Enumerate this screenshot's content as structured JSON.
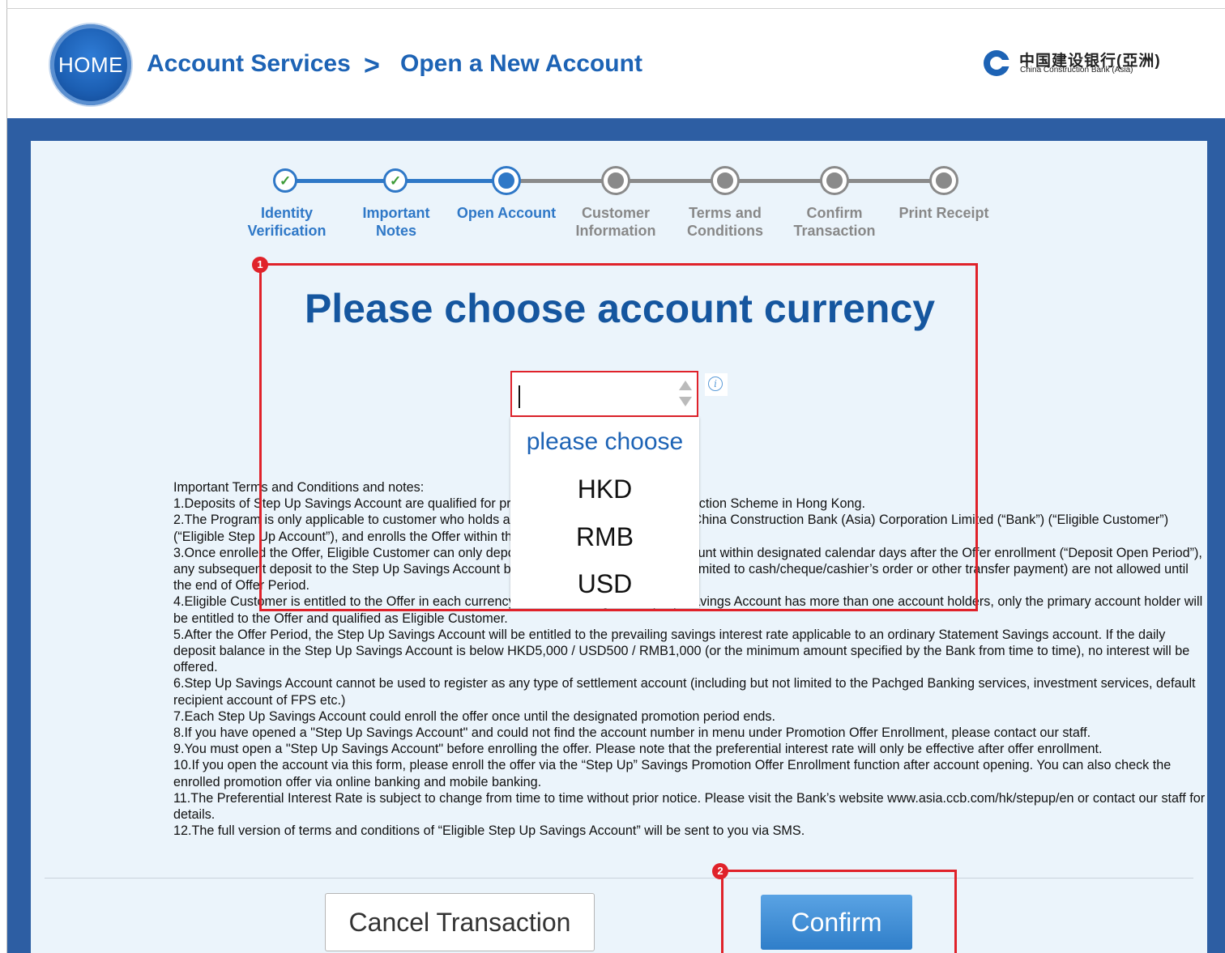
{
  "header": {
    "home_label": "HOME",
    "breadcrumb": [
      "Account Services",
      "Open a New Account"
    ],
    "breadcrumb_separator": ">",
    "bank_name_cn": "中国建设银行(亞洲)",
    "bank_name_en": "China Construction Bank (Asia)"
  },
  "steps": [
    {
      "label": "Identity Verification",
      "state": "done"
    },
    {
      "label": "Important Notes",
      "state": "done"
    },
    {
      "label": "Open Account",
      "state": "current"
    },
    {
      "label": "Customer Information",
      "state": "todo"
    },
    {
      "label": "Terms and Conditions",
      "state": "todo"
    },
    {
      "label": "Confirm Transaction",
      "state": "todo"
    },
    {
      "label": "Print Receipt",
      "state": "todo"
    }
  ],
  "annotations": [
    "1",
    "2"
  ],
  "main": {
    "title": "Please choose account currency",
    "currency_select": {
      "value": "",
      "options": [
        "please choose",
        "HKD",
        "RMB",
        "USD"
      ]
    },
    "info_icon": "i"
  },
  "terms": [
    "Important Terms and Conditions and notes:",
    "1.Deposits of Step Up Savings Account are qualified for protection under the Deposit Protection Scheme in Hong Kong.",
    "2.The Program is only applicable to customer who holds a Step Up Savings Account with China Construction Bank (Asia) Corporation Limited (“Bank”) (“Eligible Customer”) (“Eligible Step Up Account”), and enrolls the Offer within the Promotion Period.",
    "3.Once enrolled the Offer, Eligible Customer can only deposit to the Step Up Savings Account within designated calendar days after the Offer enrollment (“Deposit Open Period”), any subsequent deposit to the Step Up Savings Account by any means (including but not limited to cash/cheque/cashier’s order or other transfer payment) are not allowed until the end of Offer Period.",
    "4.Eligible Customer is entitled to the Offer in each currency once. If the Eligible Step Up Savings Account has more than one account holders, only the primary account holder will be entitled to the Offer and qualified as Eligible Customer.",
    "5.After the Offer Period, the Step Up Savings Account will be entitled to the prevailing savings interest rate applicable to an ordinary Statement Savings account. If the daily deposit balance in the Step Up Savings Account is below HKD5,000 / USD500 / RMB1,000 (or the minimum amount specified by the Bank from time to time), no interest will be offered.",
    "6.Step Up Savings Account cannot be used to register as any type of settlement account (including but not limited to the Pachged Banking services, investment services, default recipient account of FPS etc.)",
    "7.Each Step Up Savings Account could enroll the offer once until the designated promotion period ends.",
    "8.If you have opened a \"Step Up Savings Account\" and could not find the account number in menu under Promotion Offer Enrollment, please contact our staff.",
    "9.You must open a \"Step Up Savings Account\" before enrolling the offer. Please note that the preferential interest rate will only be effective after offer enrollment.",
    "10.If you open the account via this form, please enroll the offer via the “Step Up” Savings Promotion Offer Enrollment function after account opening. You can also check the enrolled promotion offer via online banking and mobile banking.",
    "11.The Preferential Interest Rate is subject to change from time to time without prior notice. Please visit the Bank’s website www.asia.ccb.com/hk/stepup/en or contact our staff for details.",
    "12.The full version of terms and conditions of “Eligible Step Up Savings Account” will be sent to you via SMS."
  ],
  "buttons": {
    "cancel": "Cancel Transaction",
    "confirm": "Confirm"
  },
  "colors": {
    "primary_blue": "#1d63b5",
    "header_bar": "#2d5ea3",
    "panel_bg": "#ebf4fb",
    "highlight_red": "#e0222a",
    "done_check": "#3a9a35",
    "inactive_grey": "#8a8a8a"
  }
}
